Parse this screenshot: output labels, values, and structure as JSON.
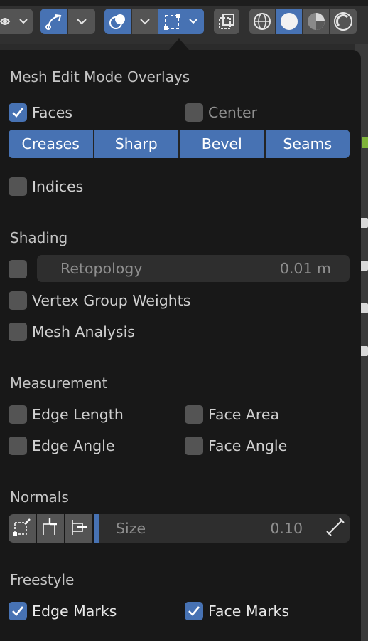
{
  "header": {
    "icons": [
      "visibility-eye-icon",
      "gizmo-icon",
      "overlays-icon",
      "mesh-edit-overlays-icon",
      "xray-icon",
      "wireframe-shading-icon",
      "solid-shading-icon",
      "material-shading-icon",
      "rendered-shading-icon"
    ]
  },
  "panel": {
    "title": "Mesh Edit Mode Overlays",
    "faces": {
      "label": "Faces",
      "checked": true
    },
    "center": {
      "label": "Center",
      "checked": false
    },
    "toggles": [
      "Creases",
      "Sharp",
      "Bevel",
      "Seams"
    ],
    "indices": {
      "label": "Indices",
      "checked": false
    },
    "shading": {
      "title": "Shading",
      "retopology": {
        "label": "Retopology",
        "value": "0.01 m",
        "checked": false
      },
      "vertex_group_weights": {
        "label": "Vertex Group Weights",
        "checked": false
      },
      "mesh_analysis": {
        "label": "Mesh Analysis",
        "checked": false
      }
    },
    "measurement": {
      "title": "Measurement",
      "edge_length": {
        "label": "Edge Length",
        "checked": false
      },
      "face_area": {
        "label": "Face Area",
        "checked": false
      },
      "edge_angle": {
        "label": "Edge Angle",
        "checked": false
      },
      "face_angle": {
        "label": "Face Angle",
        "checked": false
      }
    },
    "normals": {
      "title": "Normals",
      "size_label": "Size",
      "size_value": "0.10"
    },
    "freestyle": {
      "title": "Freestyle",
      "edge_marks": {
        "label": "Edge Marks",
        "checked": true
      },
      "face_marks": {
        "label": "Face Marks",
        "checked": true
      }
    }
  },
  "colors": {
    "accent": "#4772b3",
    "panel_bg": "#181818",
    "checkbox_off": "#545454"
  }
}
